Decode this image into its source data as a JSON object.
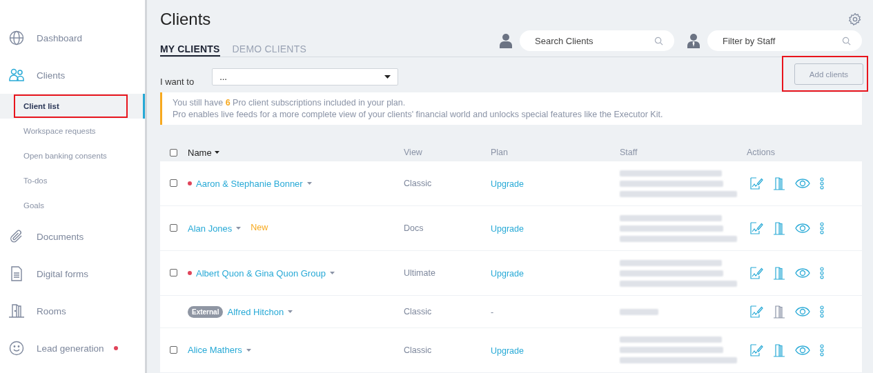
{
  "sidebar": {
    "items": [
      {
        "kind": "globe",
        "label": "Dashboard",
        "selected": false
      },
      {
        "kind": "people",
        "label": "Clients",
        "selected": true,
        "children": [
          {
            "label": "Client list",
            "selected": true,
            "highlighted": true
          },
          {
            "label": "Workspace requests",
            "selected": false,
            "highlighted": false
          },
          {
            "label": "Open banking consents",
            "selected": false,
            "highlighted": false
          },
          {
            "label": "To-dos",
            "selected": false,
            "highlighted": false
          },
          {
            "label": "Goals",
            "selected": false,
            "highlighted": false
          }
        ]
      },
      {
        "kind": "paperclip",
        "label": "Documents",
        "selected": false
      },
      {
        "kind": "form",
        "label": "Digital forms",
        "selected": false
      },
      {
        "kind": "door",
        "label": "Rooms",
        "selected": false
      },
      {
        "kind": "smiley",
        "label": "Lead generation",
        "selected": false,
        "badge_dot": true
      }
    ]
  },
  "page": {
    "title": "Clients"
  },
  "tabs": [
    {
      "label": "MY CLIENTS",
      "selected": true
    },
    {
      "label": "DEMO CLIENTS",
      "selected": false
    }
  ],
  "search": {
    "placeholder": "Search Clients"
  },
  "staff_filter": {
    "placeholder": "Filter by Staff"
  },
  "action_bar": {
    "label": "I want to",
    "select_value": "...",
    "add_button": "Add clients",
    "add_highlighted": true
  },
  "notice": {
    "lines": [
      "You still have **6** Pro client subscriptions included in your plan.",
      "Pro enables live feeds for a more complete view of your clients' financial world and unlocks special features like the Executor Kit."
    ]
  },
  "table": {
    "all_checked": false,
    "columns": [
      "Name",
      "View",
      "Plan",
      "Staff",
      "Actions"
    ],
    "rows": [
      {
        "checked": false,
        "color": "#e0445a",
        "name": "Aaron & Stephanie Bonner",
        "view": "Classic",
        "plan": "Upgrade",
        "staff_many": true,
        "room_enabled": true
      },
      {
        "checked": false,
        "name": "Alan Jones",
        "tag": "New",
        "view": "Docs",
        "plan": "Upgrade",
        "staff_many": true,
        "room_enabled": true
      },
      {
        "checked": false,
        "color": "#e0445a",
        "name": "Albert Quon & Gina Quon Group",
        "view": "Ultimate",
        "plan": "Upgrade",
        "staff_many": true,
        "room_enabled": true
      },
      {
        "badge": "External",
        "name": "Alfred Hitchon",
        "view": "Classic",
        "plan": "-",
        "staff_many": false,
        "room_enabled": false
      },
      {
        "checked": false,
        "name": "Alice Mathers",
        "view": "Classic",
        "plan": "Upgrade",
        "staff_many": true,
        "room_enabled": true
      }
    ]
  }
}
